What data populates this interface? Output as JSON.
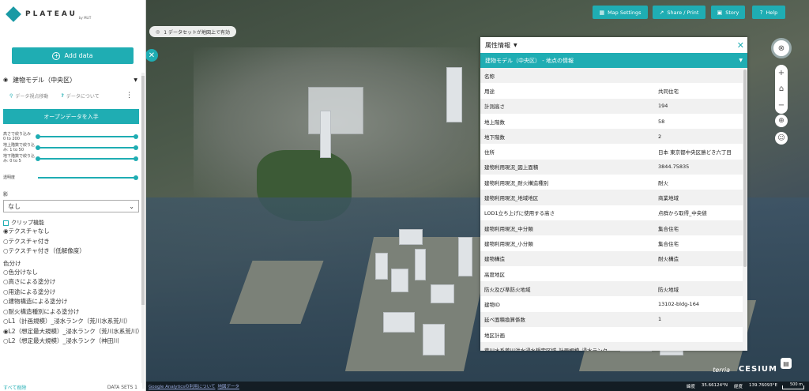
{
  "app": {
    "logo": "PLATEAU",
    "logo_sub": "by MLIT"
  },
  "sidebar": {
    "add_data": "Add data",
    "item": {
      "title": "建物モデル（中央区）",
      "link_move": "データ視点移動",
      "link_about": "データについて",
      "open_data": "オープンデータを入手"
    },
    "sliders": [
      {
        "label": "高さで絞り込み\n0 to 200",
        "range": [
          0,
          1
        ]
      },
      {
        "label": "地上階数で絞り込み: 1 to 50",
        "range": [
          0,
          1
        ]
      },
      {
        "label": "地下階数で絞り込み: 0 to 5",
        "range": [
          0,
          1
        ]
      }
    ],
    "opacity_label": "透明度",
    "opacity": 1,
    "shadow_label": "影",
    "shadow_value": "なし",
    "clip_label": "クリップ機能",
    "texture_options": [
      "◉テクスチャなし",
      "○テクスチャ付き",
      "○テクスチャ付き（低解像度）"
    ],
    "color_title": "色分け",
    "color_options": [
      "○色分けなし",
      "○高さによる塗分け",
      "○用途による塗分け",
      "○建物構造による塗分け",
      "○耐火構造種別による塗分け",
      "○L1（計画規模）_浸水ランク（荒川水系荒川）",
      "◉L2（想定最大規模）_浸水ランク（荒川水系荒川）",
      "○L2（想定最大規模）_浸水ランク（神田川"
    ],
    "footer_clear": "すべて削除",
    "footer_count": "DATA SETS 1"
  },
  "map": {
    "pill": "1 データセットが地図上で有効",
    "toolbar": [
      {
        "label": "Map Settings",
        "icon": "▦"
      },
      {
        "label": "Share / Print",
        "icon": "↗"
      },
      {
        "label": "Story",
        "icon": "▣"
      },
      {
        "label": "Help",
        "icon": "?"
      }
    ],
    "ga_link": "Google Analyticsの利用について",
    "map_data_link": "地図データ",
    "coord_lat_label": "緯度",
    "coord_lat": "35.66124°N",
    "coord_lon_label": "経度",
    "coord_lon": "139.76093°E",
    "scale": "500 m",
    "brand_terria": "terria",
    "brand_cesium": "CESIUM"
  },
  "panel": {
    "title": "属性情報",
    "subtitle": "建物モデル（中央区） - 地点の情報",
    "rows": [
      {
        "k": "名称",
        "v": ""
      },
      {
        "k": "用途",
        "v": "共同住宅"
      },
      {
        "k": "計測高さ",
        "v": "194"
      },
      {
        "k": "地上階数",
        "v": "58"
      },
      {
        "k": "地下階数",
        "v": "2"
      },
      {
        "k": "住所",
        "v": "日本 東京都中央区勝どき六丁目"
      },
      {
        "k": "建物利用現況_図上面積",
        "v": "3844.75835"
      },
      {
        "k": "建物利用現況_耐火構造種別",
        "v": "耐火"
      },
      {
        "k": "建物利用現況_地域地区",
        "v": "商業地域"
      },
      {
        "k": "LOD1立ち上げに使用する高さ",
        "v": "点群から取得_中央値"
      },
      {
        "k": "建物利用現況_中分類",
        "v": "集合住宅"
      },
      {
        "k": "建物利用現況_小分類",
        "v": "集合住宅"
      },
      {
        "k": "建物構造",
        "v": "耐火構造"
      },
      {
        "k": "高度地区",
        "v": ""
      },
      {
        "k": "防火及び準防火地域",
        "v": "防火地域"
      },
      {
        "k": "建物ID",
        "v": "13102-bldg-164"
      },
      {
        "k": "延べ面積換算係数",
        "v": "1"
      },
      {
        "k": "地区計画",
        "v": ""
      },
      {
        "k": "荒川水系荒川洪水浸水想定区域_計画規模_浸水ランク",
        "v": ""
      }
    ]
  }
}
